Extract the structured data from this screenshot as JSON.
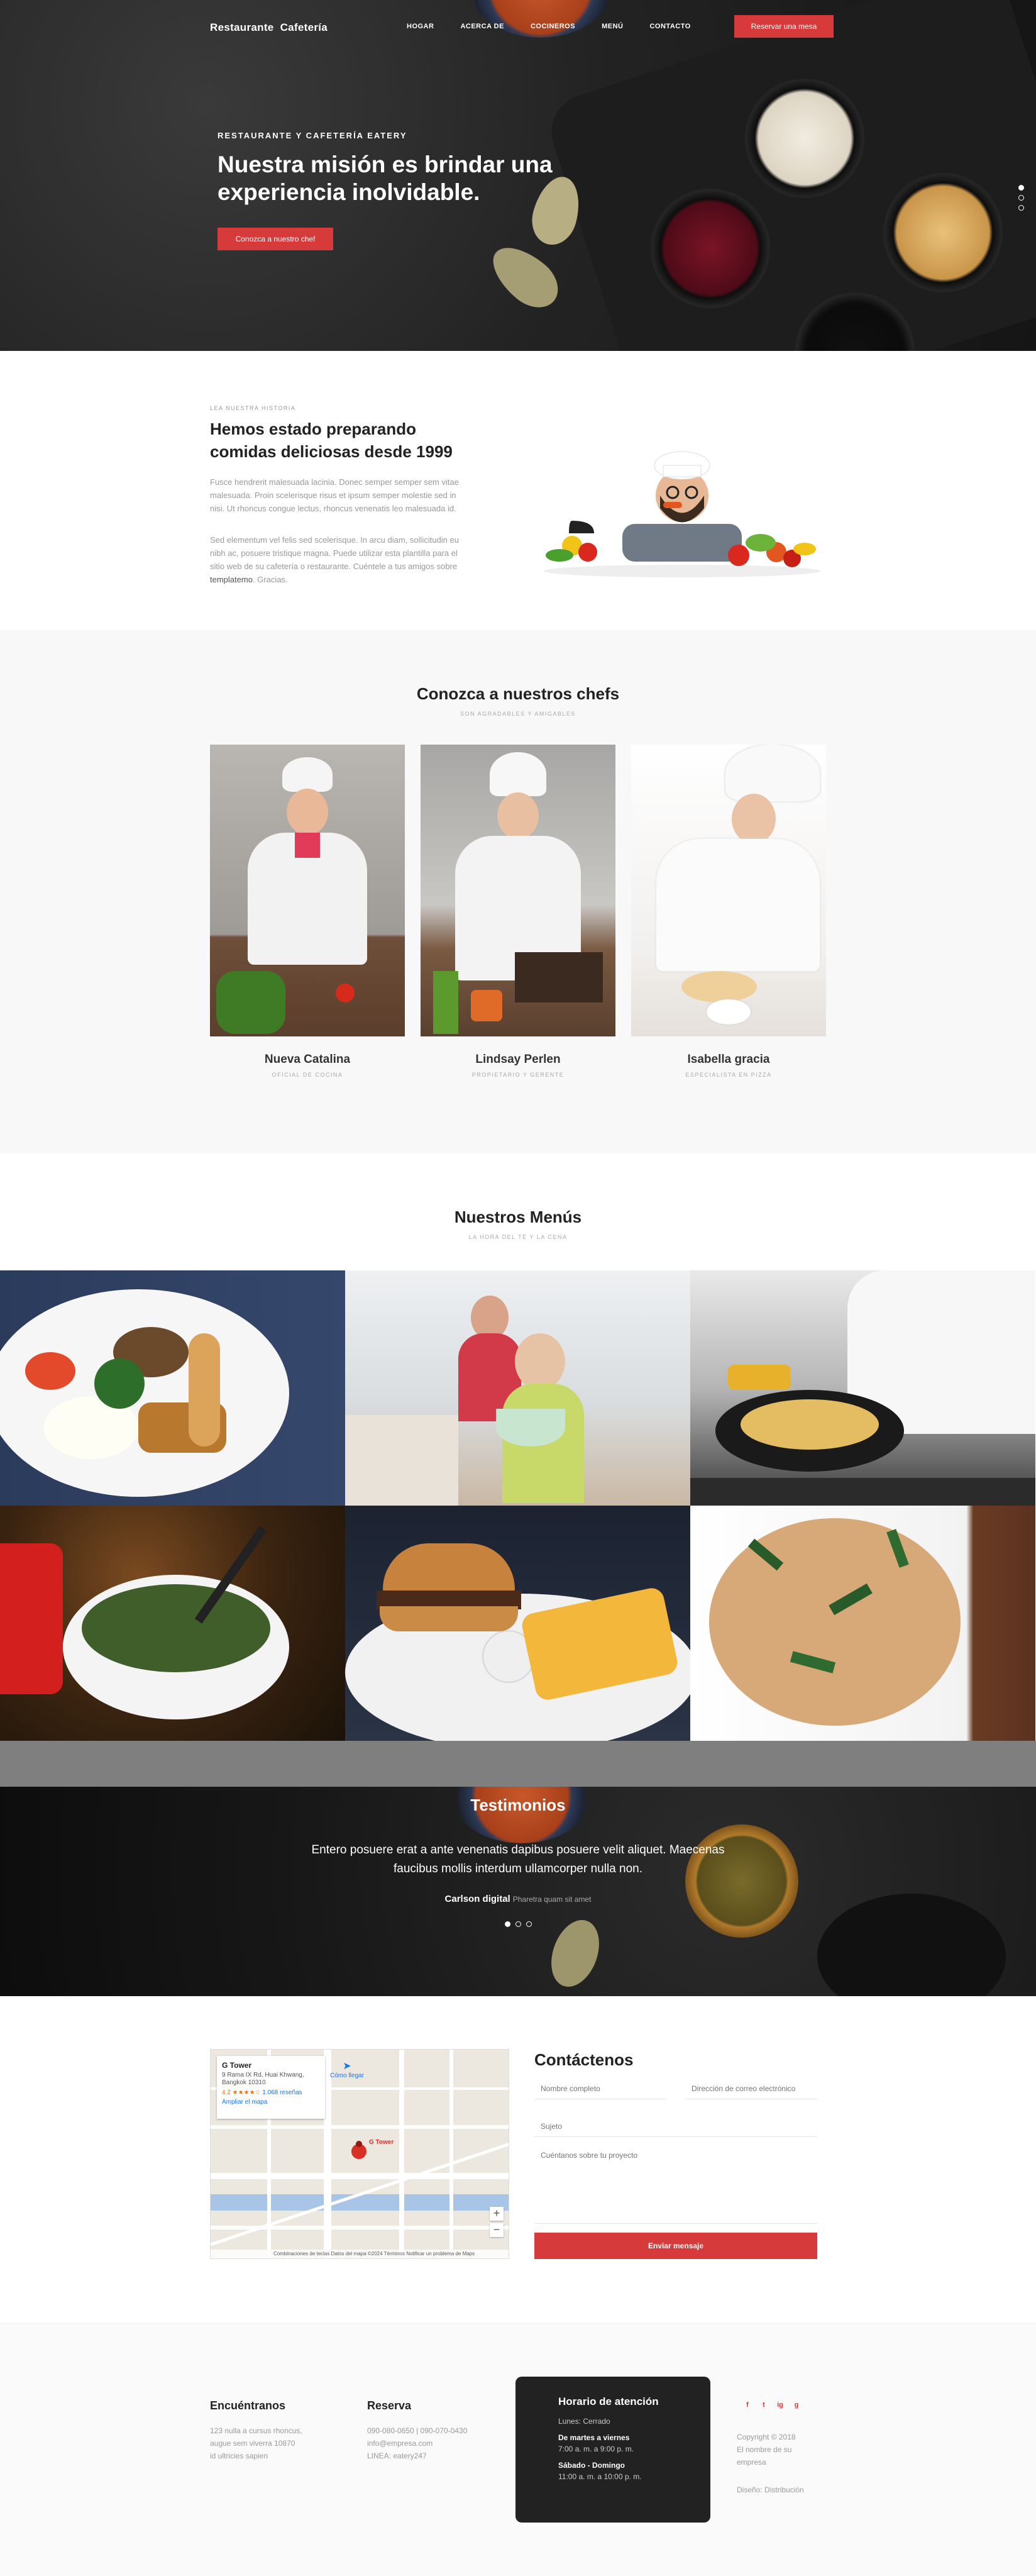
{
  "nav": {
    "brand_1": "Restaurante",
    "brand_2": "Cafetería",
    "links": [
      "HOGAR",
      "ACERCA DE",
      "COCINEROS",
      "MENÚ",
      "CONTACTO"
    ],
    "reserve": "Reservar una mesa"
  },
  "hero": {
    "kicker": "RESTAURANTE Y CAFETERÍA EATERY",
    "title": "Nuestra misión es brindar una experiencia inolvidable.",
    "button": "Conozca a nuestro chef"
  },
  "about": {
    "kicker": "LEA NUESTRA HISTORIA",
    "title": "Hemos estado preparando comidas deliciosas desde 1999",
    "p1": "Fusce hendrerit malesuada lacinia. Donec semper semper sem vitae malesuada. Proin scelerisque risus et ipsum semper molestie sed in nisi. Ut rhoncus congue lectus, rhoncus venenatis leo malesuada id.",
    "p2_a": "Sed elementum vel felis sed scelerisque. In arcu diam, sollicitudin eu nibh ac, posuere tristique magna. Puede utilizar esta plantilla para el sitio web de su cafetería o restaurante. Cuéntele a tus amigos sobre ",
    "p2_b": "templatemo",
    "p2_c": ". Gracias."
  },
  "chefs": {
    "title": "Conozca a nuestros chefs",
    "subtitle": "SON AGRADABLES Y AMIGABLES",
    "list": [
      {
        "name": "Nueva Catalina",
        "role": "OFICIAL DE COCINA"
      },
      {
        "name": "Lindsay Perlen",
        "role": "PROPIETARIO Y GERENTE"
      },
      {
        "name": "Isabella gracia",
        "role": "ESPECIALISTA EN PIZZA"
      }
    ]
  },
  "menus": {
    "title": "Nuestros Menús",
    "subtitle": "LA HORA DEL TÉ Y LA CENA",
    "tiles": [
      "breakfast",
      "family-salad",
      "wok",
      "soup",
      "burger",
      "pasta"
    ]
  },
  "testimonials": {
    "title": "Testimonios",
    "quote": "Entero posuere erat a ante venenatis dapibus posuere velit aliquet. Maecenas faucibus mollis interdum ullamcorper nulla non.",
    "author": "Carlson digital",
    "author_note": "Pharetra quam sit amet"
  },
  "map": {
    "place": "G Tower",
    "address": "9 Rama IX Rd, Huai Khwang, Bangkok 10310",
    "rating": "4.2 ★★★★☆",
    "reviews": "1.068 reseñas",
    "enlarge": "Ampliar el mapa",
    "directions": "Cómo llegar",
    "pin_label": "G Tower",
    "footer": "Combinaciones de teclas  Datos del mapa ©2024  Términos  Notificar un problema de Maps"
  },
  "contact": {
    "title": "Contáctenos",
    "name_ph": "Nombre completo",
    "email_ph": "Dirección de correo electrónico",
    "subject_ph": "Sujeto",
    "message_ph": "Cuéntanos sobre tu proyecto",
    "send": "Enviar mensaje"
  },
  "footer": {
    "find_title": "Encuéntranos",
    "find_lines": [
      "123 nulla a cursus rhoncus,",
      "augue sem viverra 10870",
      "id ultricies sapien"
    ],
    "reserve_title": "Reserva",
    "reserve_lines": [
      "090-080-0650 | 090-070-0430",
      "info@empresa.com",
      "LINEA: eatery247"
    ],
    "hours_title": "Horario de atención",
    "hours_closed": "Lunes: Cerrado",
    "hours_d1": "De martes a viernes",
    "hours_v1": "7:00 a. m. a 9:00 p. m.",
    "hours_d2": "Sábado - Domingo",
    "hours_v2": "11:00 a. m. a 10:00 p. m.",
    "copyright_lines": [
      "Copyright © 2018",
      "El nombre de su",
      "empresa"
    ],
    "distribution": "Diseño: Distribución",
    "socials": [
      "f",
      "t",
      "ig",
      "g"
    ]
  },
  "colors": {
    "accent": "#d63a3a",
    "dark": "#222222"
  }
}
